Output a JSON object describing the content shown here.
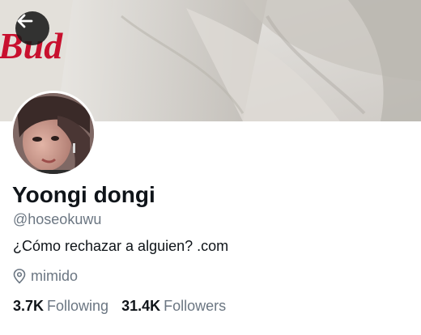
{
  "profile": {
    "display_name": "Yoongi dongi",
    "handle": "@hoseokuwu",
    "bio": "¿Cómo rechazar a alguien? .com",
    "location": "mimido"
  },
  "stats": {
    "following_count": "3.7K",
    "following_label": "Following",
    "followers_count": "31.4K",
    "followers_label": "Followers"
  },
  "banner": {
    "printed_text": "Bud"
  },
  "icons": {
    "back": "arrow-left-icon",
    "location": "location-pin-icon"
  },
  "colors": {
    "text_primary": "#0f1419",
    "text_secondary": "#6b7682",
    "background": "#ffffff"
  }
}
